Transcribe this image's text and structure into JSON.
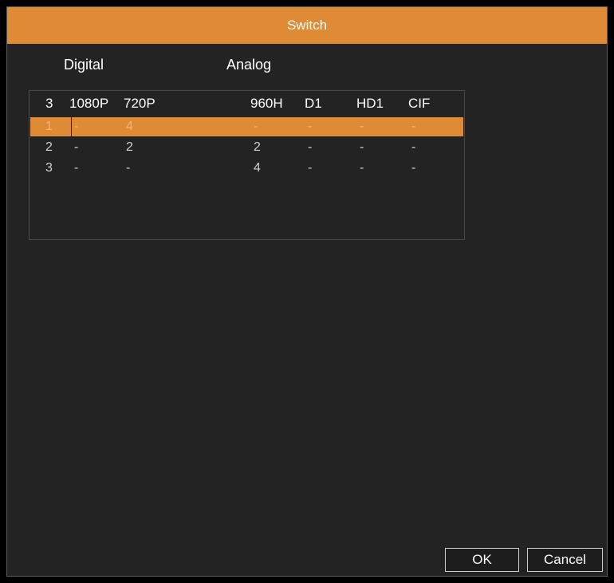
{
  "window": {
    "title": "Switch"
  },
  "sections": {
    "digital": "Digital",
    "analog": "Analog"
  },
  "table": {
    "headers": {
      "count": "3",
      "res_1080p": "1080P",
      "res_720p": "720P",
      "res_960h": "960H",
      "res_d1": "D1",
      "res_hd1": "HD1",
      "res_cif": "CIF"
    },
    "rows": [
      {
        "idx": "1",
        "res_1080p": "-",
        "res_720p": "4",
        "res_960h": "-",
        "res_d1": "-",
        "res_hd1": "-",
        "res_cif": "-",
        "selected": true
      },
      {
        "idx": "2",
        "res_1080p": "-",
        "res_720p": "2",
        "res_960h": "2",
        "res_d1": "-",
        "res_hd1": "-",
        "res_cif": "-",
        "selected": false
      },
      {
        "idx": "3",
        "res_1080p": "-",
        "res_720p": "-",
        "res_960h": "4",
        "res_d1": "-",
        "res_hd1": "-",
        "res_cif": "-",
        "selected": false
      }
    ]
  },
  "buttons": {
    "ok": "OK",
    "cancel": "Cancel"
  },
  "colors": {
    "accent": "#df8a35",
    "background": "#232323"
  }
}
